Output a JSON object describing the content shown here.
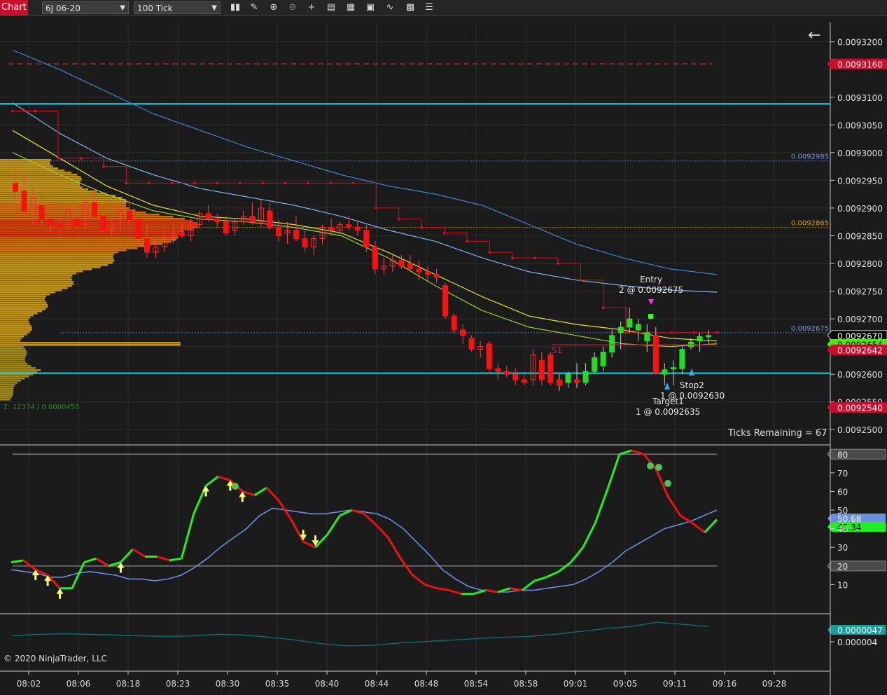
{
  "toolbar": {
    "tab_label": "Chart",
    "instrument": "6J 06-20",
    "period": "100 Tick",
    "icons": [
      "bar-type-icon",
      "drawing-tools-icon",
      "zoom-in-icon",
      "zoom-out-icon",
      "crosshair-icon",
      "data-box-icon",
      "properties-icon",
      "indicators-icon",
      "strategies-icon",
      "templates-icon",
      "menu-icon"
    ]
  },
  "overlay": {
    "copyright": "© 2020 NinjaTrader, LLC",
    "ticks_remaining": "Ticks Remaining = 67",
    "volume_profile_label": "Σ: 12374 / 0.0000450",
    "entry_label": "Entry",
    "entry_detail": "2 @ 0.0092675",
    "stop_label": "Stop2",
    "stop_detail": "1 @ 0.0092630",
    "target_label": "Target1",
    "target_detail": "1 @ 0.0092635",
    "s1_label": "S1"
  },
  "colors": {
    "background": "#1b1b1b",
    "up_candle": "#22dd22",
    "down_candle": "#ff1010",
    "cyan_line": "#19d6e6",
    "dashed_red": "#dc1e3c",
    "ema_slow": "#3d86d8",
    "ema_mid": "#7fb3ee",
    "ema_yellow": "#e2e23a",
    "ema_green": "#9cd234",
    "stoch_k_up": "#22ee22",
    "stoch_k_down": "#ee1111",
    "stoch_d": "#6a8fe0",
    "bottom_line": "#0f6d6d"
  },
  "chart_data": [
    {
      "type": "candlestick",
      "panel": "price",
      "x_tick_labels": [
        "08:02",
        "08:06",
        "08:18",
        "08:23",
        "08:30",
        "08:35",
        "08:40",
        "08:44",
        "08:48",
        "08:54",
        "08:58",
        "09:01",
        "09:05",
        "09:11",
        "09:16",
        "09:28"
      ],
      "y_tick_labels": [
        "0.0093200",
        "0.0093100",
        "0.0093050",
        "0.0093000",
        "0.0092950",
        "0.0092900",
        "0.0092850",
        "0.0092800",
        "0.0092750",
        "0.0092700",
        "0.0092650",
        "0.0092600",
        "0.0092550",
        "0.0092500"
      ],
      "ylim": [
        0.0092475,
        0.0093235
      ],
      "price_labels": [
        {
          "value": "0.0093160",
          "price": 0.009316,
          "color": "#c8102e",
          "text_color": "#ffffff"
        },
        {
          "value": "0.0092670",
          "price": 0.009267,
          "color": "#000000",
          "text_color": "#ffffff"
        },
        {
          "value": "0.0092654",
          "price": 0.0092654,
          "color": "#4ee612",
          "text_color": "#000000"
        },
        {
          "value": "0.0092642",
          "price": 0.0092644,
          "color": "#c8102e",
          "text_color": "#ffffff"
        },
        {
          "value": "0.0092540",
          "price": 0.009254,
          "color": "#c8102e",
          "text_color": "#ffffff"
        }
      ],
      "level_labels": [
        {
          "value": "0.0092985",
          "price": 0.0092985,
          "color": "#6d9be8"
        },
        {
          "value": "0.0092865",
          "price": 0.0092865,
          "color": "#d49a2a"
        },
        {
          "value": "0.0092675",
          "price": 0.0092675,
          "color": "#6d9be8"
        }
      ],
      "horizontal_lines": [
        {
          "price": 0.0093088,
          "style": "solid",
          "color": "#19d6e6"
        },
        {
          "price": 0.0092602,
          "style": "solid",
          "color": "#19d6e6"
        },
        {
          "price": 0.009316,
          "style": "dashed",
          "color": "#dc1e3c"
        }
      ],
      "candles": [
        {
          "o": 0.0092945,
          "h": 0.0092975,
          "l": 0.0092905,
          "c": 0.009293
        },
        {
          "o": 0.009293,
          "h": 0.009296,
          "l": 0.009288,
          "c": 0.0092895
        },
        {
          "o": 0.009289,
          "h": 0.0092935,
          "l": 0.009287,
          "c": 0.009292
        },
        {
          "o": 0.0092905,
          "h": 0.0092935,
          "l": 0.009287,
          "c": 0.009288
        },
        {
          "o": 0.009288,
          "h": 0.0092915,
          "l": 0.0092855,
          "c": 0.009287
        },
        {
          "o": 0.009287,
          "h": 0.009289,
          "l": 0.009285,
          "c": 0.0092865
        },
        {
          "o": 0.009287,
          "h": 0.009291,
          "l": 0.009286,
          "c": 0.0092895
        },
        {
          "o": 0.009288,
          "h": 0.00929,
          "l": 0.009286,
          "c": 0.0092868
        },
        {
          "o": 0.009287,
          "h": 0.009292,
          "l": 0.0092862,
          "c": 0.009291
        },
        {
          "o": 0.009291,
          "h": 0.0092935,
          "l": 0.009288,
          "c": 0.0092885
        },
        {
          "o": 0.0092885,
          "h": 0.009291,
          "l": 0.0092855,
          "c": 0.009286
        },
        {
          "o": 0.009286,
          "h": 0.009288,
          "l": 0.0092845,
          "c": 0.009287
        },
        {
          "o": 0.009287,
          "h": 0.0092905,
          "l": 0.009286,
          "c": 0.0092895
        },
        {
          "o": 0.0092895,
          "h": 0.009291,
          "l": 0.009287,
          "c": 0.009288
        },
        {
          "o": 0.009288,
          "h": 0.0092895,
          "l": 0.009284,
          "c": 0.0092845
        },
        {
          "o": 0.0092845,
          "h": 0.009287,
          "l": 0.009281,
          "c": 0.009282
        },
        {
          "o": 0.009282,
          "h": 0.0092845,
          "l": 0.009281,
          "c": 0.009283
        },
        {
          "o": 0.009283,
          "h": 0.009286,
          "l": 0.009282,
          "c": 0.009285
        },
        {
          "o": 0.0092845,
          "h": 0.009287,
          "l": 0.0092835,
          "c": 0.0092855
        },
        {
          "o": 0.0092855,
          "h": 0.0092875,
          "l": 0.0092845,
          "c": 0.009285
        },
        {
          "o": 0.009285,
          "h": 0.009288,
          "l": 0.009284,
          "c": 0.009287
        },
        {
          "o": 0.009287,
          "h": 0.0092895,
          "l": 0.0092865,
          "c": 0.009289
        },
        {
          "o": 0.009289,
          "h": 0.0092905,
          "l": 0.0092875,
          "c": 0.009288
        },
        {
          "o": 0.009288,
          "h": 0.009289,
          "l": 0.0092865,
          "c": 0.0092875
        },
        {
          "o": 0.0092875,
          "h": 0.0092885,
          "l": 0.009285,
          "c": 0.0092855
        },
        {
          "o": 0.009286,
          "h": 0.009288,
          "l": 0.009285,
          "c": 0.0092875
        },
        {
          "o": 0.0092875,
          "h": 0.0092895,
          "l": 0.009287,
          "c": 0.0092885
        },
        {
          "o": 0.0092885,
          "h": 0.009291,
          "l": 0.009287,
          "c": 0.0092875
        },
        {
          "o": 0.0092875,
          "h": 0.0092915,
          "l": 0.0092865,
          "c": 0.00929
        },
        {
          "o": 0.0092895,
          "h": 0.009291,
          "l": 0.009286,
          "c": 0.0092865
        },
        {
          "o": 0.0092865,
          "h": 0.009288,
          "l": 0.009284,
          "c": 0.009285
        },
        {
          "o": 0.0092855,
          "h": 0.0092875,
          "l": 0.0092835,
          "c": 0.009286
        },
        {
          "o": 0.009286,
          "h": 0.0092885,
          "l": 0.009284,
          "c": 0.0092845
        },
        {
          "o": 0.0092845,
          "h": 0.009286,
          "l": 0.009282,
          "c": 0.009283
        },
        {
          "o": 0.009283,
          "h": 0.009285,
          "l": 0.0092815,
          "c": 0.0092845
        },
        {
          "o": 0.0092845,
          "h": 0.009287,
          "l": 0.0092835,
          "c": 0.0092865
        },
        {
          "o": 0.0092865,
          "h": 0.009288,
          "l": 0.009285,
          "c": 0.009286
        },
        {
          "o": 0.009286,
          "h": 0.0092875,
          "l": 0.009285,
          "c": 0.009287
        },
        {
          "o": 0.009287,
          "h": 0.0092885,
          "l": 0.009286,
          "c": 0.0092865
        },
        {
          "o": 0.0092865,
          "h": 0.0092875,
          "l": 0.009285,
          "c": 0.009286
        },
        {
          "o": 0.009286,
          "h": 0.009287,
          "l": 0.009282,
          "c": 0.009283
        },
        {
          "o": 0.009283,
          "h": 0.009284,
          "l": 0.009278,
          "c": 0.009279
        },
        {
          "o": 0.009279,
          "h": 0.009281,
          "l": 0.009278,
          "c": 0.0092795
        },
        {
          "o": 0.0092795,
          "h": 0.0092815,
          "l": 0.0092785,
          "c": 0.0092805
        },
        {
          "o": 0.0092805,
          "h": 0.0092815,
          "l": 0.009279,
          "c": 0.0092795
        },
        {
          "o": 0.00928,
          "h": 0.0092815,
          "l": 0.0092785,
          "c": 0.009279
        },
        {
          "o": 0.009279,
          "h": 0.0092805,
          "l": 0.009277,
          "c": 0.0092785
        },
        {
          "o": 0.0092785,
          "h": 0.0092795,
          "l": 0.009277,
          "c": 0.009278
        },
        {
          "o": 0.009278,
          "h": 0.009279,
          "l": 0.0092765,
          "c": 0.0092775
        },
        {
          "o": 0.009276,
          "h": 0.0092765,
          "l": 0.00927,
          "c": 0.0092705
        },
        {
          "o": 0.0092705,
          "h": 0.009271,
          "l": 0.0092675,
          "c": 0.009268
        },
        {
          "o": 0.009268,
          "h": 0.009269,
          "l": 0.0092655,
          "c": 0.009267
        },
        {
          "o": 0.0092665,
          "h": 0.009267,
          "l": 0.009264,
          "c": 0.0092645
        },
        {
          "o": 0.0092645,
          "h": 0.009266,
          "l": 0.009263,
          "c": 0.009265
        },
        {
          "o": 0.0092655,
          "h": 0.009266,
          "l": 0.00926,
          "c": 0.009261
        },
        {
          "o": 0.009261,
          "h": 0.009262,
          "l": 0.009259,
          "c": 0.0092605
        },
        {
          "o": 0.0092605,
          "h": 0.0092615,
          "l": 0.0092595,
          "c": 0.00926
        },
        {
          "o": 0.00926,
          "h": 0.009261,
          "l": 0.009258,
          "c": 0.009259
        },
        {
          "o": 0.009259,
          "h": 0.00926,
          "l": 0.009258,
          "c": 0.0092585
        },
        {
          "o": 0.009259,
          "h": 0.0092645,
          "l": 0.009258,
          "c": 0.0092635
        },
        {
          "o": 0.0092625,
          "h": 0.009264,
          "l": 0.009258,
          "c": 0.009259
        },
        {
          "o": 0.0092635,
          "h": 0.009264,
          "l": 0.009258,
          "c": 0.0092585
        },
        {
          "o": 0.009259,
          "h": 0.00926,
          "l": 0.009257,
          "c": 0.009258
        },
        {
          "o": 0.0092585,
          "h": 0.0092605,
          "l": 0.0092575,
          "c": 0.00926
        },
        {
          "o": 0.009259,
          "h": 0.009262,
          "l": 0.0092575,
          "c": 0.0092585
        },
        {
          "o": 0.0092585,
          "h": 0.009262,
          "l": 0.009258,
          "c": 0.0092605
        },
        {
          "o": 0.0092605,
          "h": 0.009264,
          "l": 0.00926,
          "c": 0.009263
        },
        {
          "o": 0.0092615,
          "h": 0.009265,
          "l": 0.0092605,
          "c": 0.009264
        },
        {
          "o": 0.009264,
          "h": 0.009268,
          "l": 0.009263,
          "c": 0.009267
        },
        {
          "o": 0.0092675,
          "h": 0.0092695,
          "l": 0.0092645,
          "c": 0.0092685
        },
        {
          "o": 0.0092685,
          "h": 0.009272,
          "l": 0.0092675,
          "c": 0.00927
        },
        {
          "o": 0.009268,
          "h": 0.00927,
          "l": 0.009266,
          "c": 0.009269
        },
        {
          "o": 0.009266,
          "h": 0.009269,
          "l": 0.009264,
          "c": 0.0092675
        },
        {
          "o": 0.009267,
          "h": 0.0092685,
          "l": 0.00926,
          "c": 0.0092602
        },
        {
          "o": 0.00926,
          "h": 0.009262,
          "l": 0.009258,
          "c": 0.0092608
        },
        {
          "o": 0.009261,
          "h": 0.0092625,
          "l": 0.009258,
          "c": 0.0092612
        },
        {
          "o": 0.009261,
          "h": 0.009265,
          "l": 0.00926,
          "c": 0.0092645
        },
        {
          "o": 0.009265,
          "h": 0.0092665,
          "l": 0.0092645,
          "c": 0.0092658
        },
        {
          "o": 0.009266,
          "h": 0.0092675,
          "l": 0.009264,
          "c": 0.0092668
        },
        {
          "o": 0.0092668,
          "h": 0.009268,
          "l": 0.0092655,
          "c": 0.009267
        }
      ],
      "ema_slow": [
        0.0093185,
        0.009315,
        0.009311,
        0.009307,
        0.009304,
        0.009301,
        0.0092985,
        0.009296,
        0.009294,
        0.0092925,
        0.0092905,
        0.009287,
        0.0092835,
        0.009281,
        0.009279,
        0.009278
      ],
      "ema_mid": [
        0.009309,
        0.0093035,
        0.009299,
        0.009296,
        0.0092935,
        0.009292,
        0.0092905,
        0.0092885,
        0.009286,
        0.009284,
        0.009281,
        0.0092785,
        0.009277,
        0.009276,
        0.0092752,
        0.0092748
      ],
      "ema_yellow": [
        0.009304,
        0.009299,
        0.009294,
        0.0092905,
        0.0092885,
        0.009288,
        0.009287,
        0.0092855,
        0.009282,
        0.009278,
        0.009274,
        0.0092705,
        0.009269,
        0.009268,
        0.0092665,
        0.009266
      ],
      "ema_green": [
        0.0093,
        0.009296,
        0.0092925,
        0.0092895,
        0.009288,
        0.0092875,
        0.0092865,
        0.009285,
        0.009281,
        0.009276,
        0.0092715,
        0.0092685,
        0.009267,
        0.0092655,
        0.009265,
        0.0092655
      ],
      "trail_stop": [
        0.0093075,
        0.0093075,
        0.009299,
        0.009299,
        0.0092975,
        0.0092945,
        0.0092945,
        0.0092945,
        0.0092945,
        0.0092945,
        0.0092945,
        0.0092945,
        0.0092945,
        0.0092945,
        0.0092945,
        0.0092945,
        0.00929,
        0.009288,
        0.0092865,
        0.0092855,
        0.009284,
        0.009282,
        0.009281,
        0.009281,
        0.00928,
        0.009277,
        0.009272,
        0.0092675,
        0.0092675,
        0.0092675,
        0.0092675,
        0.0092675
      ],
      "volume_profile_poc": 0.0092865
    },
    {
      "type": "line",
      "panel": "stochastic",
      "y_tick_labels": [
        "80",
        "70",
        "60",
        "50",
        "40",
        "30",
        "20",
        "10"
      ],
      "ylim": [
        0,
        100
      ],
      "levels": [
        {
          "value": 80,
          "label": "80"
        },
        {
          "value": 20,
          "label": "20"
        }
      ],
      "value_labels": [
        {
          "value": "50.68",
          "color": "#6a8fe0",
          "level": 50.68
        },
        {
          "value": "46.34",
          "color": "#22ee22",
          "level": 46.34
        }
      ],
      "k_values": [
        22,
        23,
        18,
        15,
        8,
        8,
        22,
        24,
        20,
        22,
        29,
        25,
        25,
        23,
        24,
        48,
        63,
        68,
        66,
        60,
        58,
        62,
        55,
        45,
        33,
        30,
        37,
        47,
        50,
        48,
        42,
        35,
        24,
        15,
        10,
        8,
        7,
        5,
        5,
        7,
        6,
        8,
        7,
        12,
        14,
        17,
        22,
        30,
        43,
        61,
        80,
        82,
        80,
        72,
        57,
        47,
        43,
        38,
        45
      ],
      "d_values": [
        18,
        17,
        16,
        14,
        14,
        16,
        17,
        16,
        15,
        13,
        13,
        12,
        13,
        15,
        19,
        24,
        30,
        35,
        40,
        47,
        51,
        50,
        49,
        48,
        48,
        49,
        50,
        49,
        48,
        45,
        40,
        33,
        26,
        18,
        13,
        9,
        7,
        6,
        6,
        7,
        7,
        8,
        9,
        10,
        13,
        17,
        22,
        28,
        32,
        36,
        40,
        42,
        44,
        47,
        50
      ],
      "arrows_up": [
        2,
        3,
        4,
        9,
        16,
        18,
        19
      ],
      "arrows_down": [
        24,
        25
      ]
    },
    {
      "type": "line",
      "panel": "oscillator",
      "y_tick_labels": [
        "0.000004"
      ],
      "value_labels": [
        {
          "value": "0.0000047",
          "color": "#1a9d9d"
        }
      ],
      "values": [
        2.9e-06,
        3.1e-06,
        3.2e-06,
        3.1e-06,
        3e-06,
        2.9e-06,
        2.8e-06,
        2.9e-06,
        3.1e-06,
        3e-06,
        2.7e-06,
        2.3e-06,
        1.8e-06,
        1.5e-06,
        1.6e-06,
        1.9e-06,
        2.1e-06,
        2.3e-06,
        2.5e-06,
        2.7e-06,
        2.8e-06,
        3.1e-06,
        3.5e-06,
        3.9e-06,
        4.2e-06,
        4.8e-06,
        4.5e-06,
        4.2e-06
      ]
    }
  ]
}
